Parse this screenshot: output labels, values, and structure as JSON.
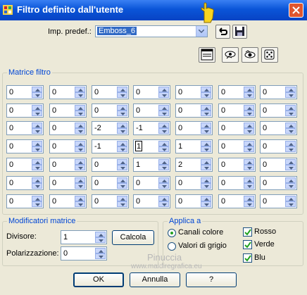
{
  "window": {
    "title": "Filtro definito dall'utente"
  },
  "preset": {
    "label": "Imp. predef.:",
    "value": "Emboss_6"
  },
  "matrix": {
    "legend": "Matrice filtro",
    "selected": [
      3,
      3
    ],
    "rows": [
      [
        "0",
        "0",
        "0",
        "0",
        "0",
        "0",
        "0"
      ],
      [
        "0",
        "0",
        "0",
        "0",
        "0",
        "0",
        "0"
      ],
      [
        "0",
        "0",
        "-2",
        "-1",
        "0",
        "0",
        "0"
      ],
      [
        "0",
        "0",
        "-1",
        "1",
        "1",
        "0",
        "0"
      ],
      [
        "0",
        "0",
        "0",
        "1",
        "2",
        "0",
        "0"
      ],
      [
        "0",
        "0",
        "0",
        "0",
        "0",
        "0",
        "0"
      ],
      [
        "0",
        "0",
        "0",
        "0",
        "0",
        "0",
        "0"
      ]
    ]
  },
  "modifiers": {
    "legend": "Modificatori matrice",
    "divisor_label": "Divisore:",
    "divisor_value": "1",
    "calc_label": "Calcola",
    "bias_label": "Polarizzazione:",
    "bias_value": "0"
  },
  "apply": {
    "legend": "Applica a",
    "channels_label": "Canali colore",
    "grey_label": "Valori di grigio",
    "selected_option": "Canali colore",
    "red_label": "Rosso",
    "green_label": "Verde",
    "blue_label": "Blu",
    "red_checked": true,
    "green_checked": true,
    "blue_checked": true
  },
  "buttons": {
    "ok": "OK",
    "cancel": "Annulla",
    "help": "?"
  },
  "watermark": {
    "name": "Pinuccia",
    "url": "www.maidiregrafica.eu"
  },
  "colors": {
    "titlebar": "#0a55d8",
    "accent": "#0046d5",
    "dialog_bg": "#ece9d8",
    "close": "#e0562f"
  }
}
